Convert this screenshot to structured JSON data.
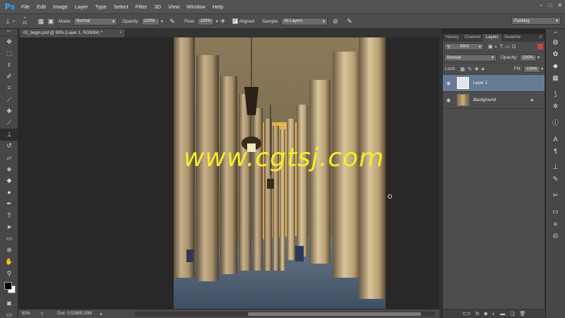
{
  "app": {
    "logo": "Ps"
  },
  "menu": [
    "File",
    "Edit",
    "Image",
    "Layer",
    "Type",
    "Select",
    "Filter",
    "3D",
    "View",
    "Window",
    "Help"
  ],
  "window_controls": [
    "–",
    "□",
    "✕"
  ],
  "options": {
    "brush_size": "21",
    "mode_label": "Mode:",
    "mode_value": "Normal",
    "opacity_label": "Opacity:",
    "opacity_value": "100%",
    "flow_label": "Flow:",
    "flow_value": "100%",
    "aligned_label": "Aligned",
    "sample_label": "Sample:",
    "sample_value": "All Layers",
    "workspace": "Painting"
  },
  "document": {
    "tab_title": "02_begin.psd @ 50% (Layer 1, RGB/8#) *",
    "close": "×"
  },
  "status": {
    "zoom": "50%",
    "doc_info": "Doc: 3.52M/8.20M"
  },
  "watermark": "www.cgtsj.com",
  "layers_panel": {
    "tabs": [
      "History",
      "Channel",
      "Layers",
      "Swatche"
    ],
    "filter_kind": "Kind",
    "blend_mode": "Normal",
    "opacity_label": "Opacity:",
    "opacity_value": "100%",
    "lock_label": "Lock:",
    "fill_label": "Fill:",
    "fill_value": "100%",
    "layers": [
      {
        "name": "Layer 1",
        "selected": true
      },
      {
        "name": "Background",
        "selected": false
      }
    ]
  }
}
